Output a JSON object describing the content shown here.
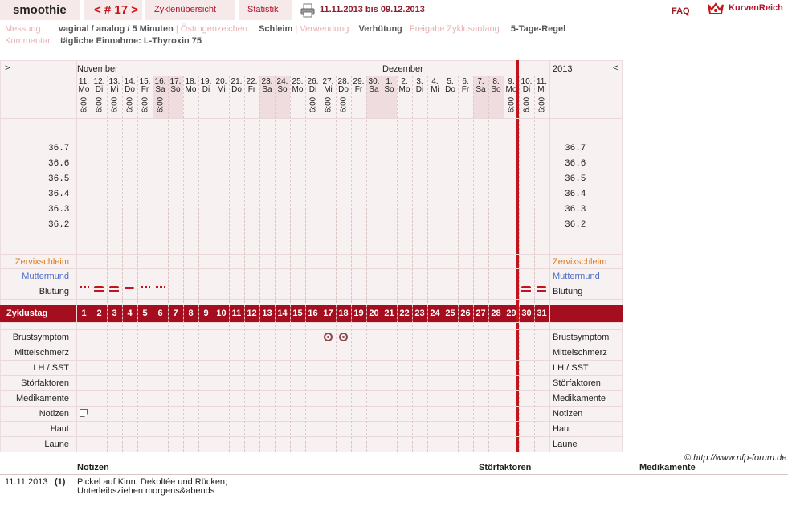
{
  "tabs": {
    "name": "smoothie",
    "cycle": "< # 17 >",
    "overview": "Zyklenübersicht",
    "stats": "Statistik"
  },
  "date_range": "11.11.2013 bis 09.12.2013",
  "faq": "FAQ",
  "logo": "KurvenReich",
  "info": {
    "messung_label": "Messung:",
    "messung_value": "vaginal / analog / 5 Minuten",
    "oestrogen_label": "Östrogenzeichen:",
    "oestrogen_value": "Schleim",
    "verwendung_label": "Verwendung:",
    "verwendung_value": "Verhütung",
    "freigabe_label": "Freigabe Zyklusanfang:",
    "freigabe_value": "5-Tage-Regel",
    "kommentar_label": "Kommentar:",
    "kommentar_value": "tägliche Einnahme: L-Thyroxin 75"
  },
  "chart": {
    "expand_left": ">",
    "expand_right": "<",
    "month1": "November",
    "month2": "Dezember",
    "year": "2013",
    "days": [
      {
        "d": "11.",
        "w": "Mo",
        "t": "6:00"
      },
      {
        "d": "12.",
        "w": "Di",
        "t": "6:00"
      },
      {
        "d": "13.",
        "w": "Mi",
        "t": "6:00"
      },
      {
        "d": "14.",
        "w": "Do",
        "t": "6:00"
      },
      {
        "d": "15.",
        "w": "Fr",
        "t": "6:00"
      },
      {
        "d": "16.",
        "w": "Sa",
        "t": "6:00"
      },
      {
        "d": "17.",
        "w": "So",
        "t": ""
      },
      {
        "d": "18.",
        "w": "Mo",
        "t": ""
      },
      {
        "d": "19.",
        "w": "Di",
        "t": ""
      },
      {
        "d": "20.",
        "w": "Mi",
        "t": ""
      },
      {
        "d": "21.",
        "w": "Do",
        "t": ""
      },
      {
        "d": "22.",
        "w": "Fr",
        "t": ""
      },
      {
        "d": "23.",
        "w": "Sa",
        "t": ""
      },
      {
        "d": "24.",
        "w": "So",
        "t": ""
      },
      {
        "d": "25.",
        "w": "Mo",
        "t": ""
      },
      {
        "d": "26.",
        "w": "Di",
        "t": "6:00"
      },
      {
        "d": "27.",
        "w": "Mi",
        "t": "6:00"
      },
      {
        "d": "28.",
        "w": "Do",
        "t": "6:00"
      },
      {
        "d": "29.",
        "w": "Fr",
        "t": ""
      },
      {
        "d": "30.",
        "w": "Sa",
        "t": ""
      },
      {
        "d": "1.",
        "w": "So",
        "t": ""
      },
      {
        "d": "2.",
        "w": "Mo",
        "t": ""
      },
      {
        "d": "3.",
        "w": "Di",
        "t": ""
      },
      {
        "d": "4.",
        "w": "Mi",
        "t": ""
      },
      {
        "d": "5.",
        "w": "Do",
        "t": ""
      },
      {
        "d": "6.",
        "w": "Fr",
        "t": ""
      },
      {
        "d": "7.",
        "w": "Sa",
        "t": ""
      },
      {
        "d": "8.",
        "w": "So",
        "t": ""
      },
      {
        "d": "9.",
        "w": "Mo",
        "t": "6:00"
      },
      {
        "d": "10.",
        "w": "Di",
        "t": "6:00"
      },
      {
        "d": "11.",
        "w": "Mi",
        "t": "6:00"
      }
    ],
    "temps": [
      "36.7",
      "36.6",
      "36.5",
      "36.4",
      "36.3",
      "36.2"
    ],
    "row_zervix": "Zervixschleim",
    "row_muttermund": "Muttermund",
    "row_blutung": "Blutung",
    "cycle_label": "Zyklustag",
    "cycle_days": [
      "1",
      "2",
      "3",
      "4",
      "5",
      "6",
      "7",
      "8",
      "9",
      "10",
      "11",
      "12",
      "13",
      "14",
      "15",
      "16",
      "17",
      "18",
      "19",
      "20",
      "21",
      "22",
      "23",
      "24",
      "25",
      "26",
      "27",
      "28",
      "29",
      "30",
      "31"
    ],
    "rows_bottom": [
      "Brustsymptom",
      "Mittelschmerz",
      "LH / SST",
      "Störfaktoren",
      "Medikamente",
      "Notizen",
      "Haut",
      "Laune"
    ],
    "bleeding": [
      {
        "day": 1,
        "level": "spotting"
      },
      {
        "day": 2,
        "level": "heavy"
      },
      {
        "day": 3,
        "level": "heavy"
      },
      {
        "day": 4,
        "level": "medium"
      },
      {
        "day": 5,
        "level": "spotting"
      },
      {
        "day": 6,
        "level": "spotting"
      },
      {
        "day": 30,
        "level": "heavy"
      },
      {
        "day": 31,
        "level": "heavy"
      }
    ],
    "breast_days": [
      17,
      18
    ],
    "note_days": [
      1
    ]
  },
  "copyright": "© http://www.nfp-forum.de",
  "notes_table": {
    "headers": [
      "Notizen",
      "Störfaktoren",
      "Medikamente"
    ],
    "row_date": "11.11.2013",
    "row_num": "(1)",
    "row_text1": "Pickel auf Kinn, Dekoltée und Rücken;",
    "row_text2": "Unterleibsziehen morgens&abends"
  },
  "colors": {
    "accent": "#a50e1e",
    "redline": "#c4141b",
    "zervix": "#e07b16",
    "muttermund": "#4a6fc9"
  }
}
